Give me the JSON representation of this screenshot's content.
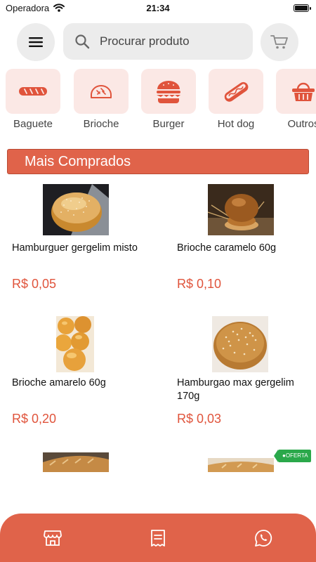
{
  "status_bar": {
    "carrier": "Operadora",
    "time": "21:34"
  },
  "search": {
    "placeholder": "Procurar produto"
  },
  "categories": [
    {
      "label": "Baguete",
      "icon": "baguette-icon"
    },
    {
      "label": "Brioche",
      "icon": "brioche-icon"
    },
    {
      "label": "Burger",
      "icon": "burger-icon"
    },
    {
      "label": "Hot dog",
      "icon": "hotdog-icon"
    },
    {
      "label": "Outros",
      "icon": "basket-icon"
    }
  ],
  "section": {
    "title": "Mais Comprados"
  },
  "products": [
    {
      "name": "Hamburguer gergelim misto",
      "price": "R$ 0,05"
    },
    {
      "name": "Brioche caramelo 60g",
      "price": "R$ 0,10"
    },
    {
      "name": "Brioche amarelo 60g",
      "price": "R$ 0,20"
    },
    {
      "name": "Hamburgao max gergelim 170g",
      "price": "R$ 0,03"
    }
  ],
  "offer_badge": "OFERTA",
  "colors": {
    "accent": "#e0634a",
    "price": "#e0543c",
    "category_bg": "#fbe8e5",
    "offer": "#2aa84a"
  },
  "bottom_nav": [
    {
      "icon": "store-icon"
    },
    {
      "icon": "receipt-icon"
    },
    {
      "icon": "whatsapp-icon"
    }
  ]
}
